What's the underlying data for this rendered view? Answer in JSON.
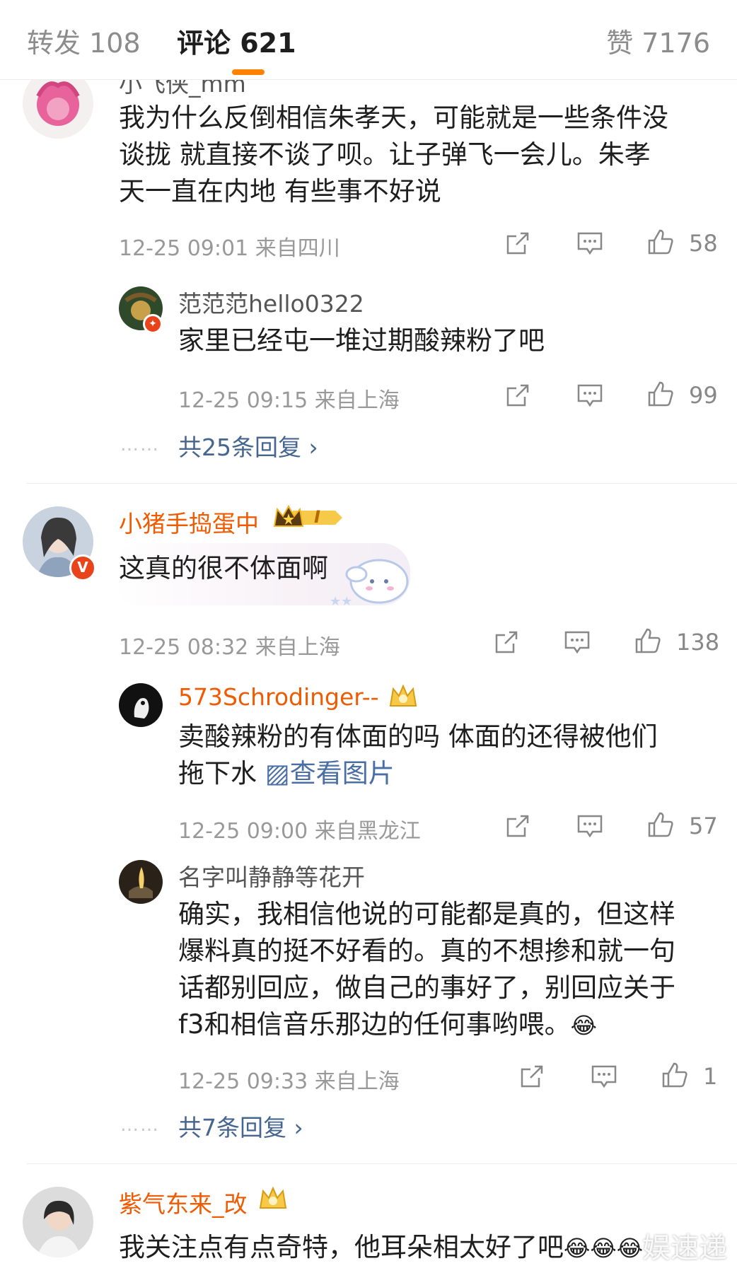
{
  "tabs": {
    "forward": "转发 108",
    "comments": "评论 621",
    "likes": "赞 7176"
  },
  "c1": {
    "name": "小飞侠_mm",
    "text_lines": [
      "我为什么反倒相信朱孝天，可能就是一些条件没",
      "谈拢 就直接不谈了呗。让子弹飞一会儿。朱孝",
      "天一直在内地 有些事不好说"
    ],
    "meta": "12-25 09:01  来自四川",
    "likes": "58"
  },
  "r1": {
    "name": "范范范hello0322",
    "text": "家里已经屯一堆过期酸辣粉了吧",
    "meta": "12-25 09:15  来自上海",
    "likes": "99"
  },
  "more1": {
    "dots": "……",
    "label": "共25条回复 ›"
  },
  "c2": {
    "name": "小猪手捣蛋中",
    "vip": "I",
    "text": "这真的很不体面啊",
    "meta": "12-25 08:32  来自上海",
    "likes": "138"
  },
  "r2": {
    "name": "573Schrodinger--",
    "text_line1": "卖酸辣粉的有体面的吗 体面的还得被他们",
    "text_line2": "拖下水 ",
    "link": "▨查看图片",
    "meta": "12-25 09:00  来自黑龙江",
    "likes": "57"
  },
  "r3": {
    "name": "名字叫静静等花开",
    "text_lines": [
      "确实，我相信他说的可能都是真的，但这样",
      "爆料真的挺不好看的。真的不想掺和就一句",
      "话都别回应，做自己的事好了，别回应关于"
    ],
    "text_last": "f3和相信音乐那边的任何事哟喂。",
    "emoji": "😂",
    "meta": "12-25 09:33  来自上海",
    "likes": "1"
  },
  "more2": {
    "dots": "……",
    "label": "共7条回复 ›"
  },
  "c3": {
    "name": "紫气东来_改",
    "text": "我关注点有点奇特，他耳朵相太好了吧",
    "emoji": "😂😂😂"
  },
  "watermark": "娱速递",
  "colors": {
    "accent": "#ff8200",
    "vip_name": "#f05a00",
    "link": "#4a6fa5",
    "more": "#46668f"
  }
}
